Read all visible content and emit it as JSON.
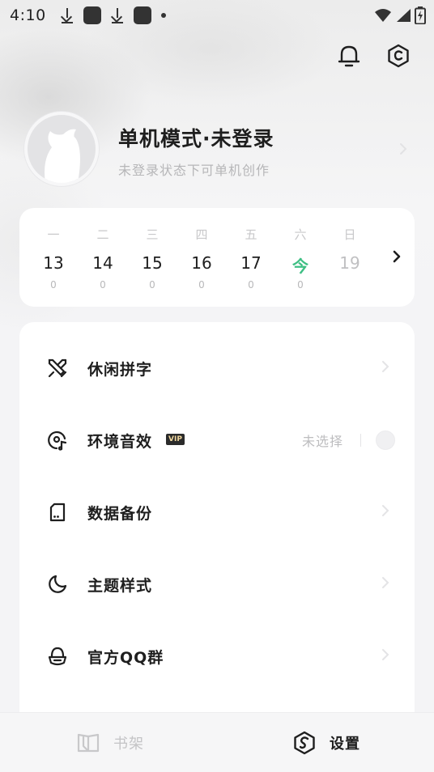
{
  "status_bar": {
    "time": "4:10",
    "icons": [
      "download-icon",
      "app-icon",
      "download-icon",
      "app-icon",
      "dot-icon",
      "wifi-icon",
      "signal-icon",
      "battery-icon"
    ]
  },
  "header": {
    "icons": [
      "bell-icon",
      "hexagon-settings-icon"
    ]
  },
  "profile": {
    "title": "单机模式·未登录",
    "subtitle": "未登录状态下可单机创作"
  },
  "calendar": {
    "days": [
      {
        "weekday": "一",
        "date": "13",
        "count": "0",
        "state": "past"
      },
      {
        "weekday": "二",
        "date": "14",
        "count": "0",
        "state": "past"
      },
      {
        "weekday": "三",
        "date": "15",
        "count": "0",
        "state": "past"
      },
      {
        "weekday": "四",
        "date": "16",
        "count": "0",
        "state": "past"
      },
      {
        "weekday": "五",
        "date": "17",
        "count": "0",
        "state": "past"
      },
      {
        "weekday": "六",
        "date": "今",
        "count": "0",
        "state": "today"
      },
      {
        "weekday": "日",
        "date": "19",
        "count": "",
        "state": "future"
      }
    ],
    "today_color": "#3fbf84"
  },
  "menu": {
    "items": [
      {
        "label": "休闲拼字",
        "icon": "crossed-swords-icon"
      },
      {
        "label": "环境音效",
        "icon": "music-disc-icon",
        "badge": "VIP",
        "value": "未选择"
      },
      {
        "label": "数据备份",
        "icon": "sd-card-icon"
      },
      {
        "label": "主题样式",
        "icon": "moon-icon"
      },
      {
        "label": "官方QQ群",
        "icon": "qq-penguin-icon"
      }
    ]
  },
  "bottom_nav": {
    "shelf_label": "书架",
    "settings_label": "设置",
    "active": "设置"
  }
}
